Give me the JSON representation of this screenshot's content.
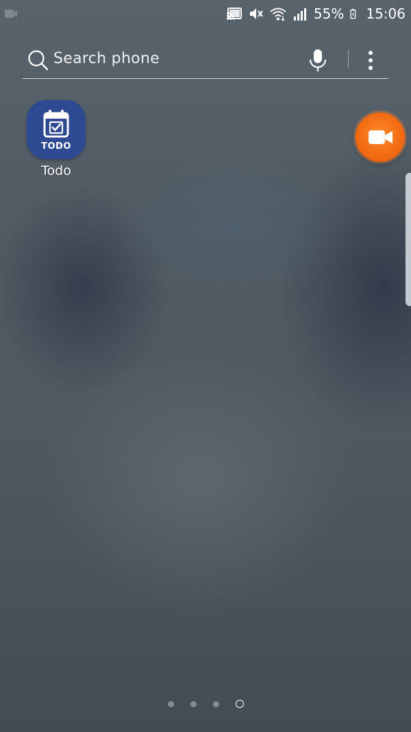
{
  "status_bar": {
    "left_icon": "screen-recorder-notification-icon",
    "icons": [
      "cast-icon",
      "mute-icon",
      "wifi-icon",
      "signal-icon"
    ],
    "battery_percent": "55%",
    "battery_icon": "battery-charging-icon",
    "time": "15:06"
  },
  "search": {
    "placeholder": "Search phone",
    "icon": "search-icon",
    "mic_icon": "mic-icon",
    "more_icon": "more-vert-icon"
  },
  "apps": [
    {
      "label": "Todo",
      "icon": "calendar-check-icon",
      "icon_text": "TODO",
      "color": "#2e4a93"
    }
  ],
  "floating_recorder": {
    "icon": "video-camera-icon",
    "color": "#f26a12"
  },
  "edge_panel": {
    "icon": "edge-handle"
  },
  "page_indicator": {
    "pages": 4,
    "current": 4
  }
}
